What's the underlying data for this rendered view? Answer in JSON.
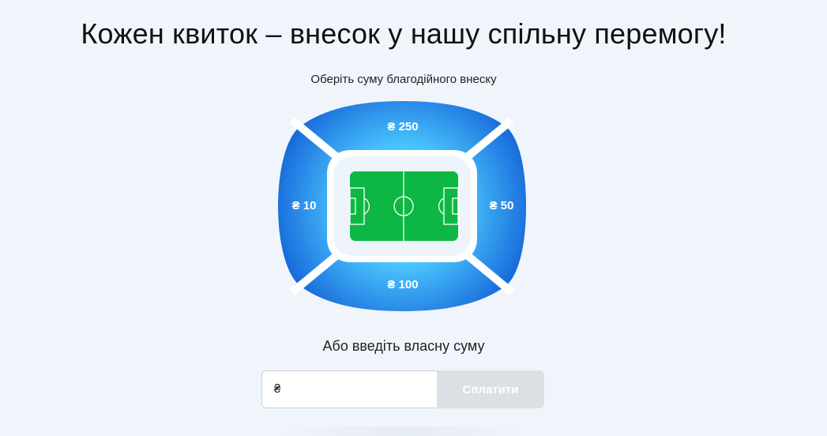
{
  "page": {
    "title": "Кожен квиток – внесок у нашу спільну перемогу!",
    "subtitle": "Оберіть суму благодійного внеску"
  },
  "stadium": {
    "sectors": {
      "top": "₴ 250",
      "left": "₴ 10",
      "right": "₴ 50",
      "bottom": "₴ 100"
    },
    "colors": {
      "sector_dark": "#1565d8",
      "sector_light": "#4cc8ff",
      "field": "#0cb843",
      "field_lines": "#ffffff",
      "ring": "#ffffff"
    }
  },
  "custom_amount": {
    "label": "Або введіть власну суму",
    "currency": "₴",
    "value": "",
    "pay_label": "Сплатити"
  }
}
